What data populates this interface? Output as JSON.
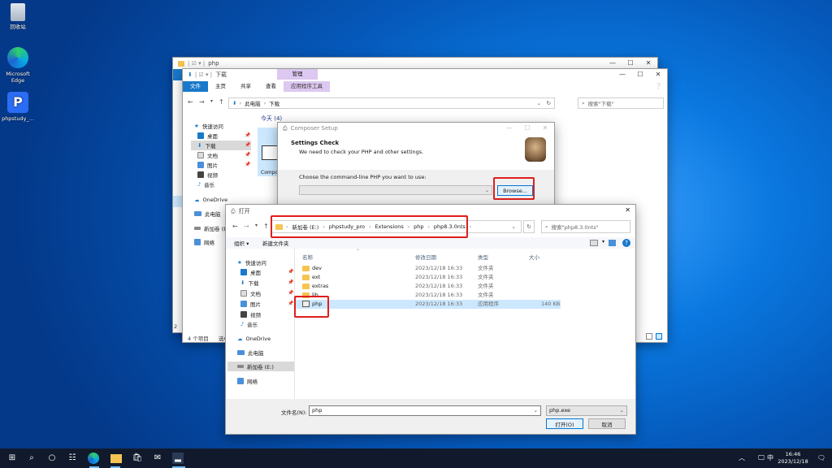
{
  "desktop": {
    "icons": [
      {
        "label": "回收站"
      },
      {
        "label": "Microsoft Edge"
      },
      {
        "label": "phpstudy_..."
      }
    ]
  },
  "explorer_back": {
    "title": "php",
    "controls": [
      "—",
      "☐",
      "✕"
    ]
  },
  "explorer": {
    "quick_title": "下载",
    "tabs": [
      "文件",
      "主页",
      "共享",
      "查看"
    ],
    "manage_label": "管理",
    "app_tools_label": "应用程序工具",
    "controls": [
      "—",
      "☐",
      "✕"
    ],
    "address": [
      "此电脑",
      "下载"
    ],
    "search_placeholder": "搜索\"下载\"",
    "group_header": "今天 (4)",
    "item_partial": "Compo",
    "sidebar": [
      "快速访问",
      "桌面",
      "下载",
      "文档",
      "图片",
      "视频",
      "音乐",
      "OneDrive",
      "此电脑",
      "新加卷 (E:)",
      "网络"
    ],
    "status_left": "4 个项目",
    "status_second": "选中",
    "status_digit": "2"
  },
  "composer": {
    "title": "Composer Setup",
    "heading": "Settings Check",
    "subheading": "We need to check your PHP and other settings.",
    "prompt": "Choose the command-line PHP you want to use:",
    "browse": "Browse...",
    "controls": [
      "—",
      "☐",
      "✕"
    ]
  },
  "open_dialog": {
    "title": "打开",
    "close": "✕",
    "breadcrumb": [
      "新加卷 (E:)",
      "phpstudy_pro",
      "Extensions",
      "php",
      "php8.3.0nts"
    ],
    "search_placeholder": "搜索\"php8.3.0nts\"",
    "organize": "组织 ▾",
    "new_folder": "新建文件夹",
    "columns": {
      "name": "名称",
      "date": "修改日期",
      "type": "类型",
      "size": "大小"
    },
    "files": [
      {
        "name": "dev",
        "date": "2023/12/18 16:33",
        "type": "文件夹",
        "size": ""
      },
      {
        "name": "ext",
        "date": "2023/12/18 16:33",
        "type": "文件夹",
        "size": ""
      },
      {
        "name": "extras",
        "date": "2023/12/18 16:33",
        "type": "文件夹",
        "size": ""
      },
      {
        "name": "lib",
        "date": "2023/12/18 16:33",
        "type": "文件夹",
        "size": ""
      },
      {
        "name": "php",
        "date": "2023/12/18 16:33",
        "type": "应用程序",
        "size": "140 KB"
      }
    ],
    "sidebar": [
      "快速访问",
      "桌面",
      "下载",
      "文档",
      "图片",
      "视频",
      "音乐",
      "OneDrive",
      "此电脑",
      "新加卷 (E:)",
      "网络"
    ],
    "filename_label": "文件名(N):",
    "filename_value": "php",
    "filetype_value": "php.exe",
    "open_button": "打开(O)",
    "cancel_button": "取消"
  },
  "taskbar": {
    "time": "16:46",
    "date": "2023/12/18",
    "ime": "中"
  }
}
